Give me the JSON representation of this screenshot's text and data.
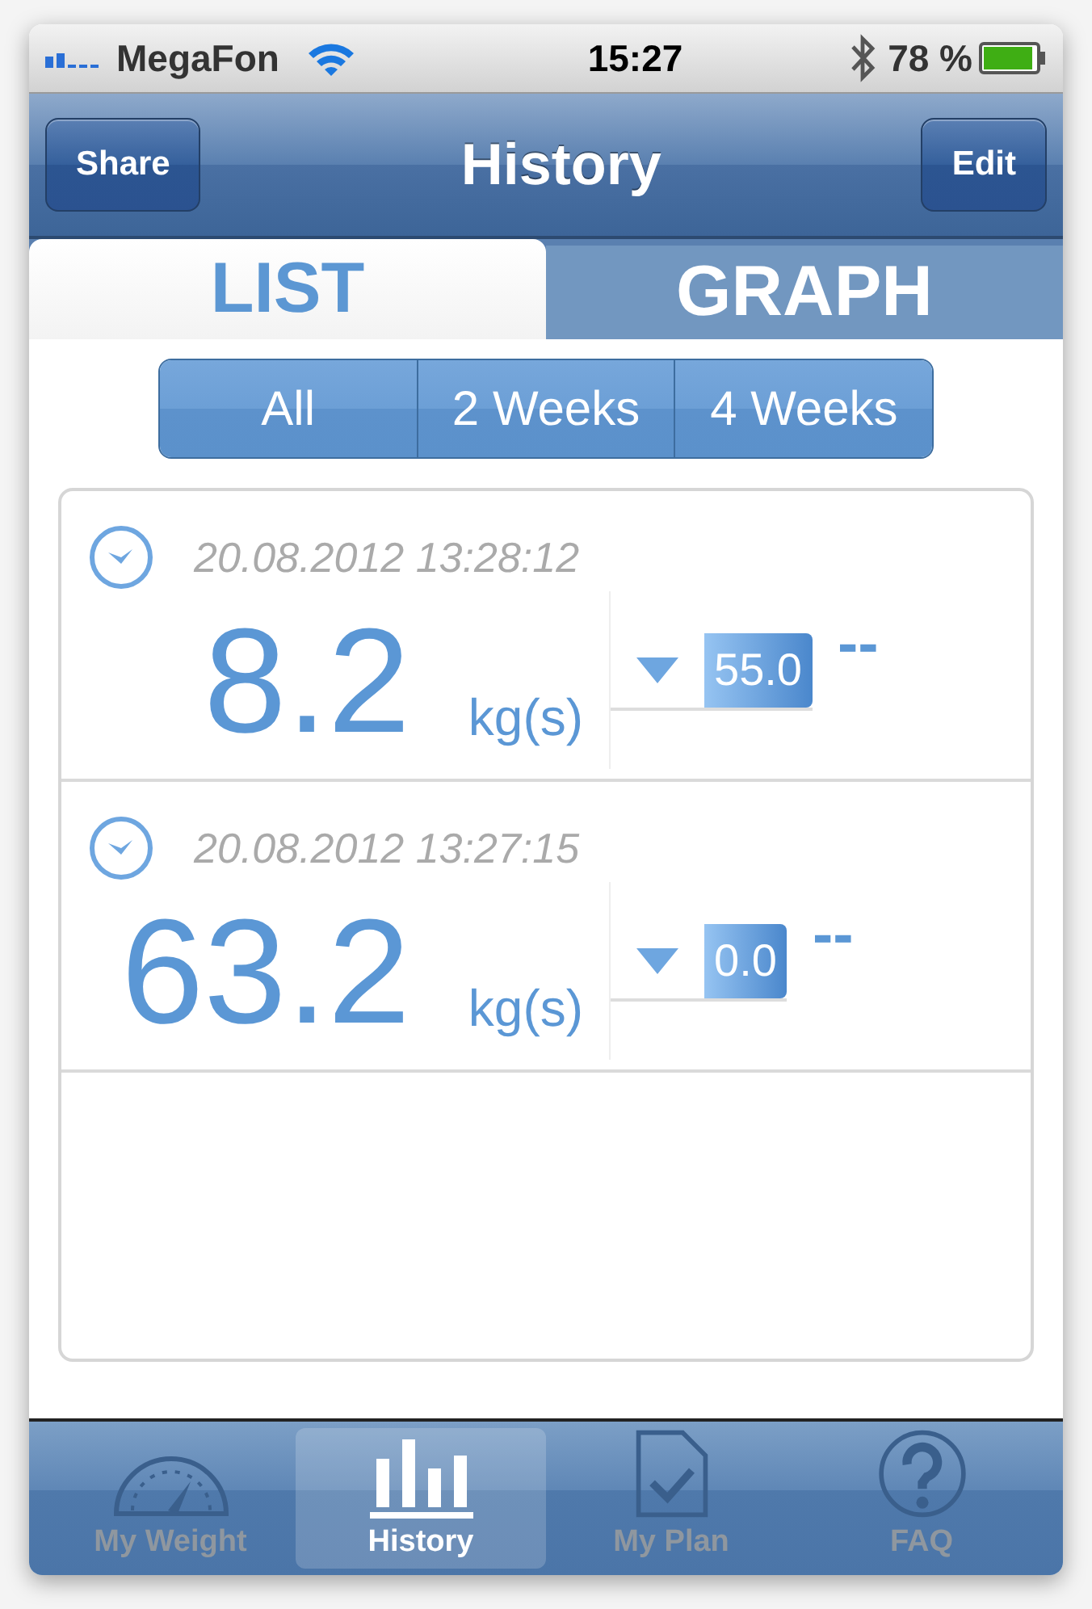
{
  "status_bar": {
    "carrier": "MegaFon",
    "time": "15:27",
    "battery": "78 %"
  },
  "nav_bar": {
    "title": "History",
    "left_button": "Share",
    "right_button": "Edit"
  },
  "tabs": [
    {
      "label": "LIST",
      "selected": true
    },
    {
      "label": "GRAPH",
      "selected": false
    }
  ],
  "filters": [
    {
      "label": "All"
    },
    {
      "label": "2 Weeks"
    },
    {
      "label": "4 Weeks"
    }
  ],
  "entries": [
    {
      "datetime": "20.08.2012 13:28:12",
      "weight": "8.2",
      "unit": "kg(s)",
      "change": "55.0",
      "note": "--"
    },
    {
      "datetime": "20.08.2012 13:27:15",
      "weight": "63.2",
      "unit": "kg(s)",
      "change": "0.0",
      "note": "--"
    }
  ],
  "tab_bar": [
    {
      "label": "My Weight",
      "selected": false
    },
    {
      "label": "History",
      "selected": true
    },
    {
      "label": "My Plan",
      "selected": false
    },
    {
      "label": "FAQ",
      "selected": false
    }
  ]
}
